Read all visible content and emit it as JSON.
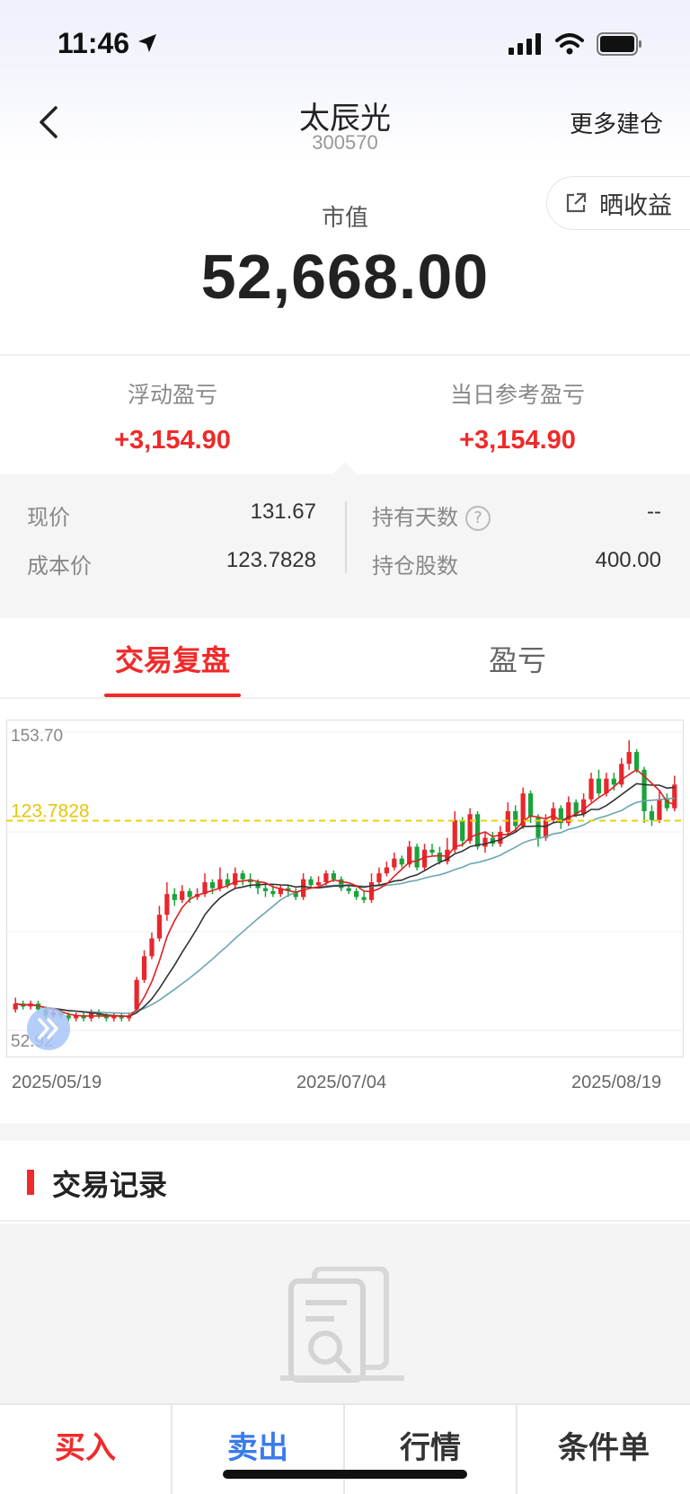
{
  "status": {
    "time": "11:46"
  },
  "header": {
    "title": "太辰光",
    "code": "300570",
    "more_label": "更多建仓"
  },
  "share_label": "晒收益",
  "market_value": {
    "label": "市值",
    "value": "52,668.00"
  },
  "pnl": {
    "floating": {
      "label": "浮动盈亏",
      "value": "+3,154.90"
    },
    "daily": {
      "label": "当日参考盈亏",
      "value": "+3,154.90"
    }
  },
  "info": {
    "price_label": "现价",
    "price_value": "131.67",
    "cost_label": "成本价",
    "cost_value": "123.7828",
    "days_label": "持有天数",
    "days_value": "--",
    "shares_label": "持仓股数",
    "shares_value": "400.00"
  },
  "tabs": [
    {
      "label": "交易复盘"
    },
    {
      "label": "盈亏"
    }
  ],
  "chart_data": {
    "type": "candlestick",
    "y_max_label": "153.70",
    "y_min_label": "52.92",
    "ylim": [
      52.92,
      153.7
    ],
    "cost_line": 123.7828,
    "cost_label": "123.7828",
    "x_labels": [
      "2025/05/19",
      "2025/07/04",
      "2025/08/19"
    ],
    "colors": {
      "up": "#e8272c",
      "down": "#1aa33c",
      "cost": "#e8d20a",
      "ma5": "#e02020",
      "ma10": "#333333",
      "ma20": "#6aa6b0"
    },
    "candles": [
      [
        60,
        62,
        64,
        59
      ],
      [
        62,
        61,
        63,
        60
      ],
      [
        61,
        62,
        63,
        60
      ],
      [
        62,
        60,
        63,
        59
      ],
      [
        60,
        58,
        61,
        57
      ],
      [
        58,
        59,
        60,
        57
      ],
      [
        59,
        58,
        60,
        57
      ],
      [
        58,
        57,
        59,
        56
      ],
      [
        57,
        58,
        59,
        56
      ],
      [
        58,
        57,
        59,
        56
      ],
      [
        57,
        59,
        60,
        56
      ],
      [
        59,
        58,
        60,
        57
      ],
      [
        58,
        57,
        59,
        56
      ],
      [
        57,
        58,
        59,
        56
      ],
      [
        58,
        57,
        59,
        56
      ],
      [
        57,
        58,
        59,
        56
      ],
      [
        60,
        70,
        71,
        59
      ],
      [
        70,
        78,
        80,
        69
      ],
      [
        78,
        84,
        86,
        77
      ],
      [
        84,
        92,
        95,
        83
      ],
      [
        92,
        99,
        103,
        90
      ],
      [
        99,
        97,
        101,
        95
      ],
      [
        97,
        100,
        102,
        96
      ],
      [
        100,
        98,
        101,
        96
      ],
      [
        98,
        99,
        101,
        97
      ],
      [
        99,
        103,
        106,
        98
      ],
      [
        103,
        101,
        104,
        99
      ],
      [
        101,
        104,
        108,
        100
      ],
      [
        104,
        102,
        106,
        101
      ],
      [
        102,
        106,
        108,
        101
      ],
      [
        106,
        104,
        107,
        102
      ],
      [
        104,
        103,
        106,
        101
      ],
      [
        103,
        101,
        104,
        99
      ],
      [
        101,
        100,
        103,
        98
      ],
      [
        100,
        99,
        102,
        98
      ],
      [
        99,
        101,
        102,
        98
      ],
      [
        101,
        100,
        102,
        98
      ],
      [
        100,
        98,
        101,
        97
      ],
      [
        98,
        104,
        106,
        97
      ],
      [
        104,
        102,
        105,
        101
      ],
      [
        102,
        103,
        105,
        101
      ],
      [
        103,
        106,
        107,
        102
      ],
      [
        106,
        104,
        107,
        103
      ],
      [
        104,
        101,
        105,
        100
      ],
      [
        101,
        100,
        102,
        99
      ],
      [
        100,
        98,
        101,
        97
      ],
      [
        98,
        97,
        100,
        96
      ],
      [
        97,
        103,
        106,
        96
      ],
      [
        103,
        106,
        108,
        102
      ],
      [
        106,
        108,
        110,
        105
      ],
      [
        108,
        111,
        113,
        107
      ],
      [
        111,
        109,
        112,
        108
      ],
      [
        109,
        115,
        117,
        108
      ],
      [
        115,
        108,
        116,
        107
      ],
      [
        108,
        114,
        116,
        107
      ],
      [
        114,
        113,
        116,
        112
      ],
      [
        113,
        110,
        115,
        109
      ],
      [
        110,
        114,
        118,
        109
      ],
      [
        114,
        124,
        127,
        113
      ],
      [
        124,
        117,
        125,
        115
      ],
      [
        117,
        126,
        128,
        116
      ],
      [
        126,
        115,
        127,
        114
      ],
      [
        115,
        118,
        120,
        113
      ],
      [
        118,
        116,
        120,
        115
      ],
      [
        116,
        120,
        122,
        115
      ],
      [
        120,
        127,
        130,
        119
      ],
      [
        127,
        122,
        129,
        120
      ],
      [
        122,
        133,
        135,
        121
      ],
      [
        133,
        125,
        134,
        123
      ],
      [
        125,
        118,
        126,
        115
      ],
      [
        118,
        124,
        126,
        117
      ],
      [
        124,
        128,
        130,
        123
      ],
      [
        128,
        123,
        129,
        121
      ],
      [
        123,
        130,
        132,
        122
      ],
      [
        130,
        126,
        131,
        125
      ],
      [
        126,
        131,
        133,
        125
      ],
      [
        131,
        138,
        140,
        130
      ],
      [
        138,
        133,
        141,
        132
      ],
      [
        133,
        138,
        140,
        132
      ],
      [
        138,
        136,
        140,
        134
      ],
      [
        136,
        143,
        145,
        135
      ],
      [
        143,
        147,
        151,
        141
      ],
      [
        147,
        141,
        148,
        140
      ],
      [
        141,
        127,
        142,
        123
      ],
      [
        127,
        124,
        129,
        122
      ],
      [
        124,
        131,
        134,
        123
      ],
      [
        131,
        128,
        133,
        127
      ],
      [
        128,
        136,
        139,
        127
      ]
    ]
  },
  "records": {
    "title": "交易记录"
  },
  "bottom": {
    "buy": "买入",
    "sell": "卖出",
    "quote": "行情",
    "conditional": "条件单"
  }
}
